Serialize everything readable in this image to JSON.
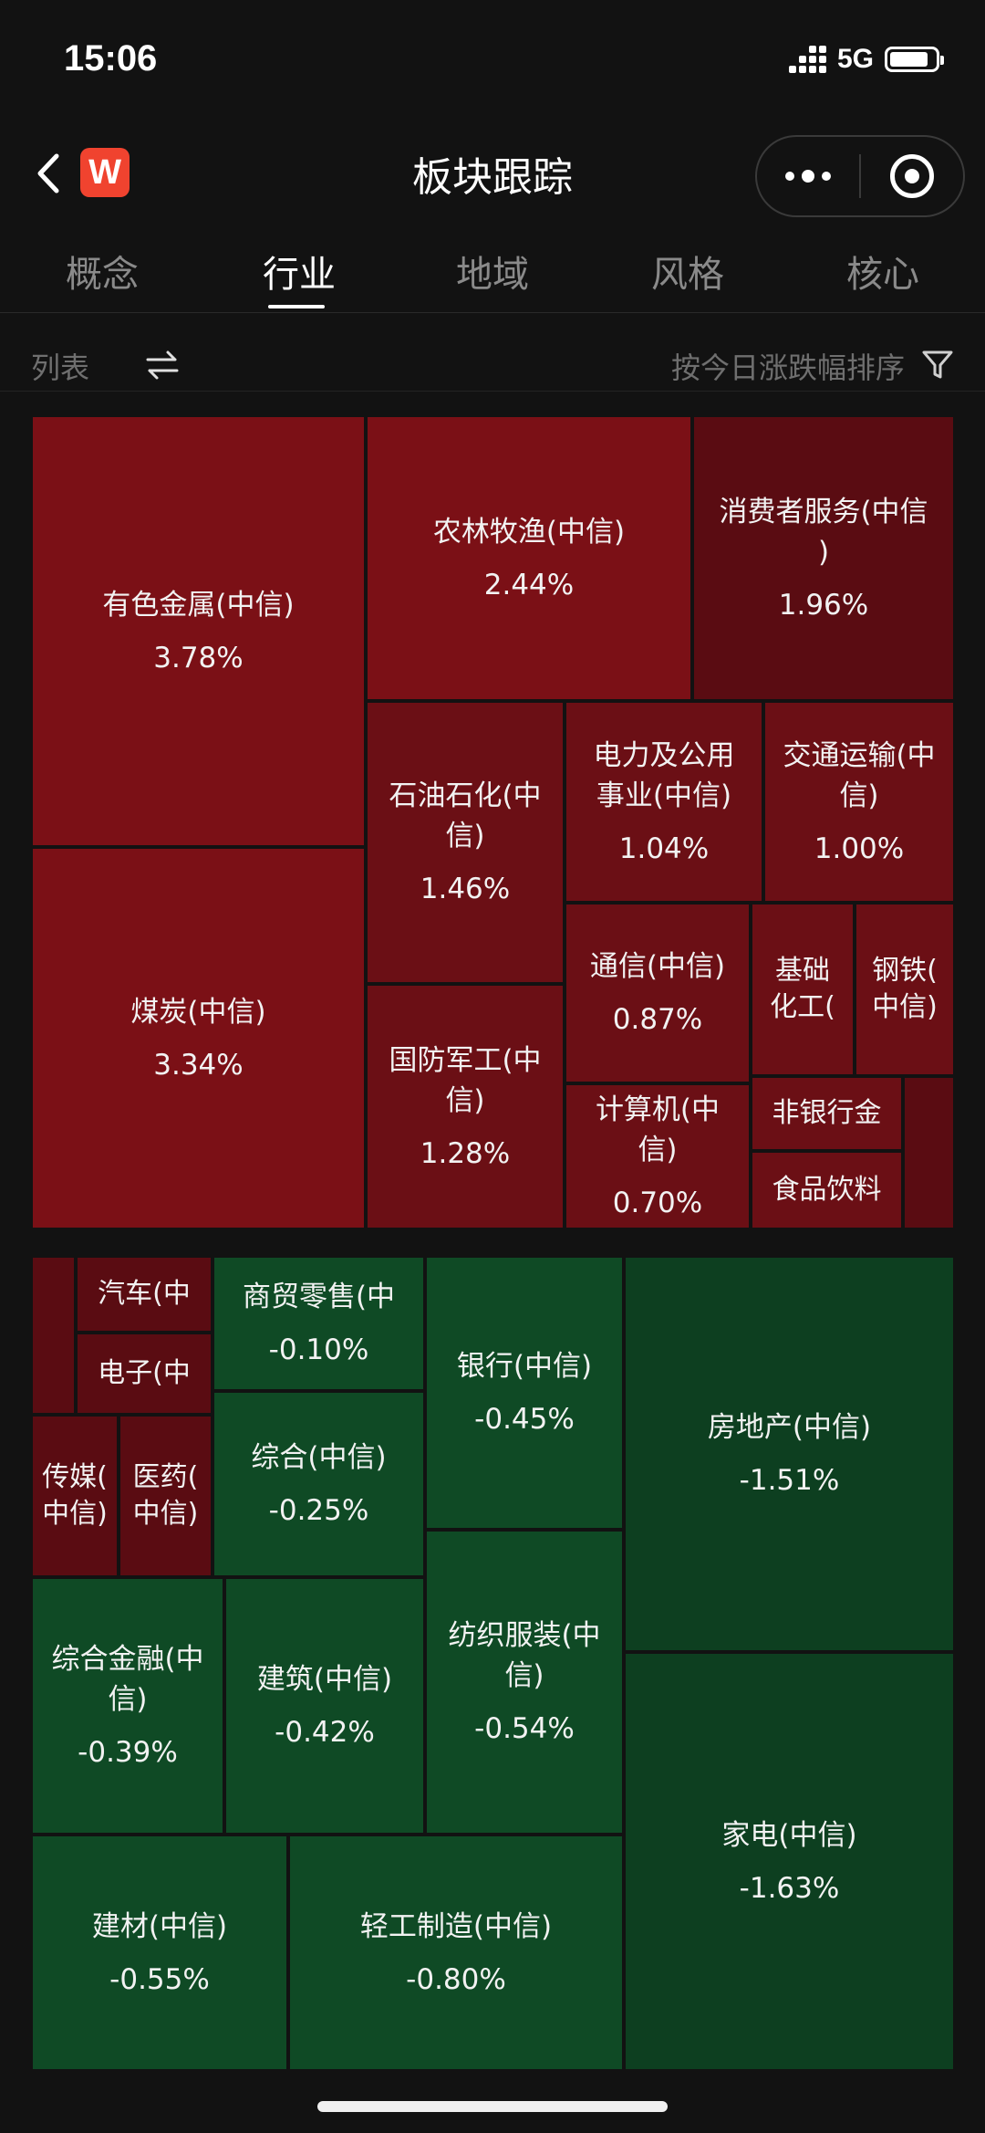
{
  "status_bar": {
    "time": "15:06",
    "network": "5G"
  },
  "nav": {
    "title": "板块跟踪",
    "logo_letter": "W"
  },
  "tabs": [
    {
      "label": "概念",
      "active": false
    },
    {
      "label": "行业",
      "active": true
    },
    {
      "label": "地域",
      "active": false
    },
    {
      "label": "风格",
      "active": false
    },
    {
      "label": "核心",
      "active": false
    }
  ],
  "toolbar": {
    "list_label": "列表",
    "sort_label": "按今日涨跌幅排序"
  },
  "colors": {
    "up_strong": "#7b1016",
    "up_mid": "#6b0f15",
    "up_weak": "#5a0c12",
    "down_weak": "#0f4a25",
    "down_strong": "#0d3f20"
  },
  "sectors": [
    {
      "name": "有色金属(中信)",
      "change": "3.78%"
    },
    {
      "name": "煤炭(中信)",
      "change": "3.34%"
    },
    {
      "name": "农林牧渔(中信)",
      "change": "2.44%"
    },
    {
      "name": "消费者服务(中信\n)",
      "change": "1.96%"
    },
    {
      "name": "石油石化(中\n信)",
      "change": "1.46%"
    },
    {
      "name": "电力及公用\n事业(中信)",
      "change": "1.04%"
    },
    {
      "name": "交通运输(中\n信)",
      "change": "1.00%"
    },
    {
      "name": "国防军工(中\n信)",
      "change": "1.28%"
    },
    {
      "name": "通信(中信)",
      "change": "0.87%"
    },
    {
      "name": "基础\n化工(",
      "change": ""
    },
    {
      "name": "钢铁(\n中信)",
      "change": ""
    },
    {
      "name": "计算机(中\n信)",
      "change": "0.70%"
    },
    {
      "name": "非银行金",
      "change": ""
    },
    {
      "name": "食品饮料",
      "change": ""
    },
    {
      "name": "",
      "change": ""
    },
    {
      "name": "",
      "change": ""
    },
    {
      "name": "汽车(中",
      "change": ""
    },
    {
      "name": "电子(中",
      "change": ""
    },
    {
      "name": "商贸零售(中",
      "change": "-0.10%"
    },
    {
      "name": "传媒(\n中信)",
      "change": ""
    },
    {
      "name": "医药(\n中信)",
      "change": ""
    },
    {
      "name": "综合(中信)",
      "change": "-0.25%"
    },
    {
      "name": "银行(中信)",
      "change": "-0.45%"
    },
    {
      "name": "房地产(中信)",
      "change": "-1.51%"
    },
    {
      "name": "综合金融(中\n信)",
      "change": "-0.39%"
    },
    {
      "name": "建筑(中信)",
      "change": "-0.42%"
    },
    {
      "name": "纺织服装(中\n信)",
      "change": "-0.54%"
    },
    {
      "name": "家电(中信)",
      "change": "-1.63%"
    },
    {
      "name": "建材(中信)",
      "change": "-0.55%"
    },
    {
      "name": "轻工制造(中信)",
      "change": "-0.80%"
    }
  ]
}
